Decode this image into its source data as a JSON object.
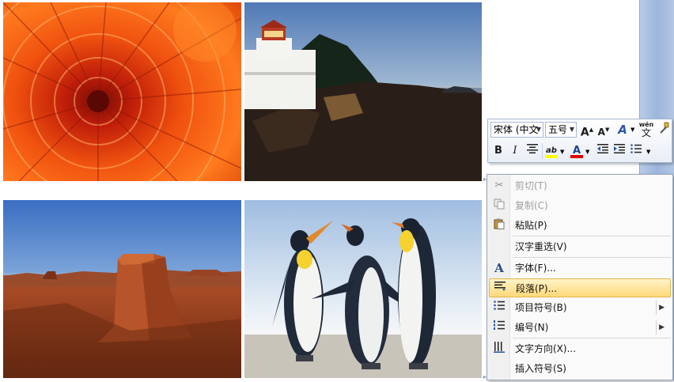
{
  "mini_toolbar": {
    "font_name": "宋体 (中文",
    "font_size": "五号",
    "grow_font": "A",
    "shrink_font": "A",
    "styles": "A",
    "phonetic_top": "wén",
    "phonetic_bottom": "文",
    "bold": "B",
    "italic": "I",
    "font_color": "A"
  },
  "context_menu": {
    "items": [
      {
        "label": "剪切(T)",
        "enabled": false,
        "icon": "scissors-icon"
      },
      {
        "label": "复制(C)",
        "enabled": false,
        "icon": "copy-icon"
      },
      {
        "label": "粘贴(P)",
        "enabled": true,
        "icon": "paste-icon"
      },
      {
        "label": "汉字重选(V)",
        "enabled": true,
        "icon": ""
      },
      {
        "label": "字体(F)...",
        "enabled": true,
        "icon": "font-icon"
      },
      {
        "label": "段落(P)...",
        "enabled": true,
        "icon": "paragraph-icon",
        "highlighted": true
      },
      {
        "label": "项目符号(B)",
        "enabled": true,
        "icon": "bullets-icon",
        "submenu": true
      },
      {
        "label": "编号(N)",
        "enabled": true,
        "icon": "numbering-icon",
        "submenu": true
      },
      {
        "label": "文字方向(X)...",
        "enabled": true,
        "icon": "text-direction-icon"
      },
      {
        "label": "插入符号(S)",
        "enabled": true,
        "icon": ""
      }
    ]
  },
  "colors": {
    "highlight": "#ffd978",
    "font_color_bar": "#e00000",
    "highlight_color_bar": "#ffff00"
  }
}
